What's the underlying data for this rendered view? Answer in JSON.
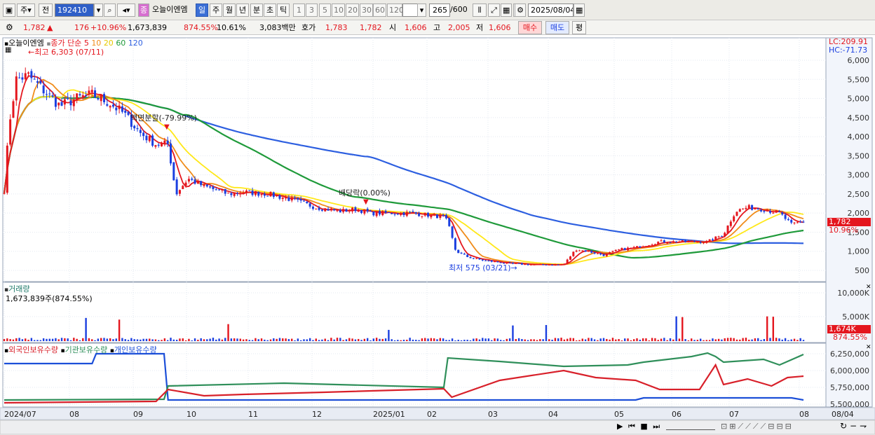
{
  "toolbar": {
    "period_label": "주",
    "prev_label": "전",
    "code_value": "192410",
    "stock_name_tag": "종",
    "stock_name": "오늘이엔엠",
    "interval_tabs": [
      "일",
      "주",
      "월",
      "년",
      "분",
      "초",
      "틱"
    ],
    "active_tab": "일",
    "tick_buttons": [
      "1",
      "3",
      "5",
      "10",
      "20",
      "30",
      "60",
      "120"
    ],
    "count_value": "265",
    "count_total": "/600",
    "date_value": "2025/08/04"
  },
  "quote": {
    "price": "1,782",
    "change_arrow": "▲",
    "change": "176",
    "change_pct": "+10.96%",
    "volume": "1,673,839",
    "volume_ratio": "874.55%",
    "turnover": "10.61%",
    "trade_value": "3,083백만",
    "ask_label": "호가",
    "ask1": "1,783",
    "ask2": "1,782",
    "open_label": "시",
    "open": "1,606",
    "high_label": "고",
    "high": "2,005",
    "low_label": "저",
    "low": "1,606",
    "buy_button": "매수",
    "sell_button": "매도",
    "eval_button": "평"
  },
  "price_panel": {
    "legend_name": "오늘이엔엠",
    "legend_line": "종가 단순",
    "ma_periods": [
      "5",
      "10",
      "20",
      "60",
      "120"
    ],
    "high_note": "최고 6,303 (07/11)",
    "low_note": "최저 575 (03/21)",
    "split_note": "액면분할(-79.99%)",
    "dividend_note": "배당락(0.00%)",
    "lc": "LC:209.91",
    "hc": "HC:-71.73",
    "last_price": "1,782",
    "last_pct": "10.96%",
    "y_ticks": [
      "6,000",
      "5,500",
      "5,000",
      "4,500",
      "4,000",
      "3,500",
      "3,000",
      "2,500",
      "2,000",
      "1,500",
      "1,000",
      "500"
    ]
  },
  "volume_panel": {
    "title": "거래량",
    "value": "1,673,839주(874.55%)",
    "y_ticks": [
      "10,000K",
      "5,000K"
    ],
    "last_value": "1,674K",
    "last_pct": "874.55%"
  },
  "holder_panel": {
    "legend_foreign": "외국인보유수량",
    "legend_institution": "기관보유수량",
    "legend_individual": "개인보유수량",
    "y_ticks": [
      "6,250,000",
      "6,000,000",
      "5,750,000",
      "5,500,000"
    ]
  },
  "x_axis": {
    "labels": [
      "2024/07",
      "08",
      "09",
      "10",
      "11",
      "12",
      "2025/01",
      "02",
      "03",
      "04",
      "05",
      "06",
      "07",
      "08"
    ],
    "end_label": "08/04"
  },
  "colors": {
    "candle_up": "#e4161e",
    "candle_down": "#1b3fe0",
    "ma5": "#e4161e",
    "ma10": "#f08c1a",
    "ma20": "#ffe81a",
    "ma60": "#1f9a3a",
    "ma120": "#2d5fe0",
    "foreign": "#d8202a",
    "institution": "#2f8f5a",
    "individual": "#1c4fd8"
  }
}
